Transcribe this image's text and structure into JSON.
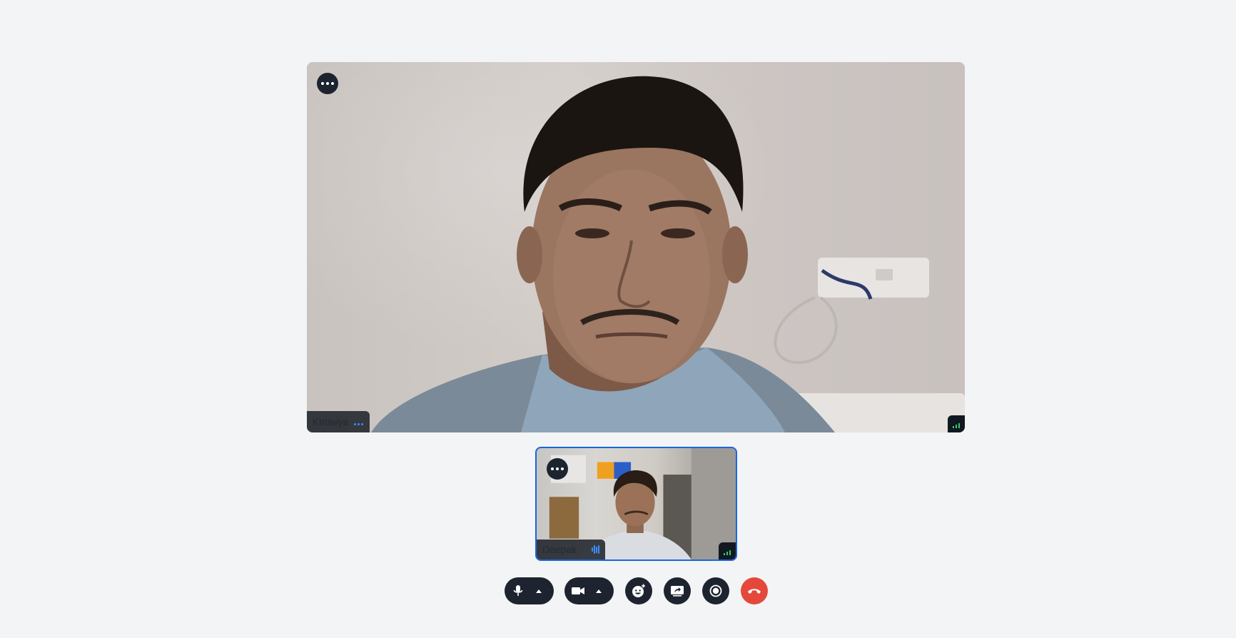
{
  "main_participant": {
    "name": "Kirtavya",
    "menu_icon": "more-horizontal-icon",
    "audio_indicator": "audio-dots-icon",
    "connection_icon": "signal-strength-icon"
  },
  "self_view": {
    "name": "Deepak",
    "menu_icon": "more-horizontal-icon",
    "audio_indicator": "speaking-wave-icon",
    "connection_icon": "signal-strength-icon",
    "active_speaker_border_color": "#1a66e0"
  },
  "toolbar": {
    "buttons": [
      {
        "id": "microphone",
        "icon": "microphone-icon",
        "has_options": true
      },
      {
        "id": "camera",
        "icon": "video-camera-icon",
        "has_options": true
      },
      {
        "id": "reactions",
        "icon": "emoji-add-icon"
      },
      {
        "id": "screen-share",
        "icon": "screen-share-icon"
      },
      {
        "id": "record",
        "icon": "record-icon"
      },
      {
        "id": "leave",
        "icon": "hang-up-icon",
        "color": "#e5483a"
      }
    ]
  },
  "colors": {
    "background": "#f3f4f5",
    "control_bg": "#1d2430",
    "hangup": "#e5483a",
    "accent": "#3f8cff",
    "signal_good": "#2ecc71"
  }
}
